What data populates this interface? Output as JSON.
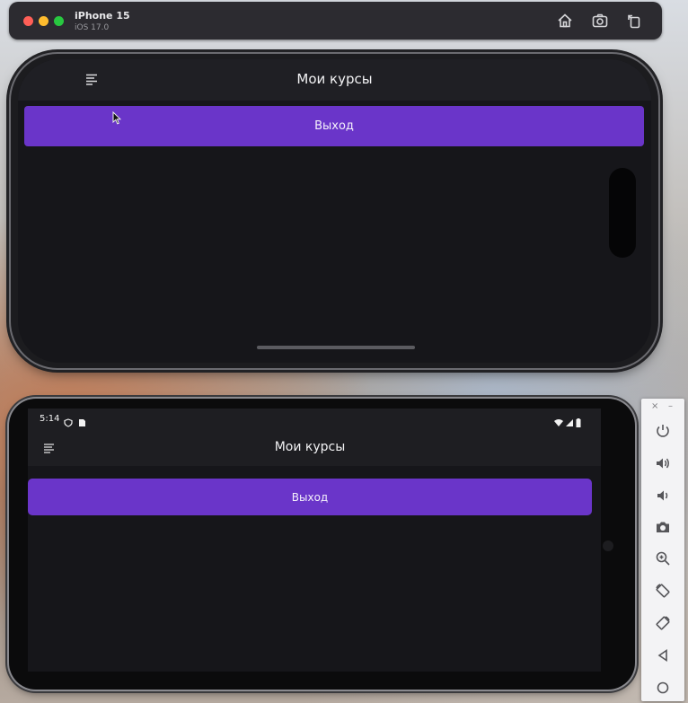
{
  "simulator": {
    "device_name": "iPhone 15",
    "os_version": "iOS 17.0",
    "toolbar_icons": [
      "home-icon",
      "screenshot-icon",
      "rotate-icon"
    ]
  },
  "ios_app": {
    "title": "Мои курсы",
    "logout_label": "Выход",
    "menu_icon": "menu-icon"
  },
  "android_app": {
    "status_time": "5:14",
    "title": "Мои курсы",
    "logout_label": "Выход",
    "menu_icon": "menu-icon"
  },
  "emulator_toolbar": {
    "window_controls": [
      "×",
      "–"
    ],
    "buttons": [
      "power-icon",
      "volume-up-icon",
      "volume-down-icon",
      "camera-icon",
      "zoom-icon",
      "rotate-left-icon",
      "rotate-right-icon",
      "back-icon",
      "home-icon"
    ]
  },
  "colors": {
    "accent": "#6a35c9",
    "app_background": "#16161a",
    "appbar": "#1f1f24"
  }
}
